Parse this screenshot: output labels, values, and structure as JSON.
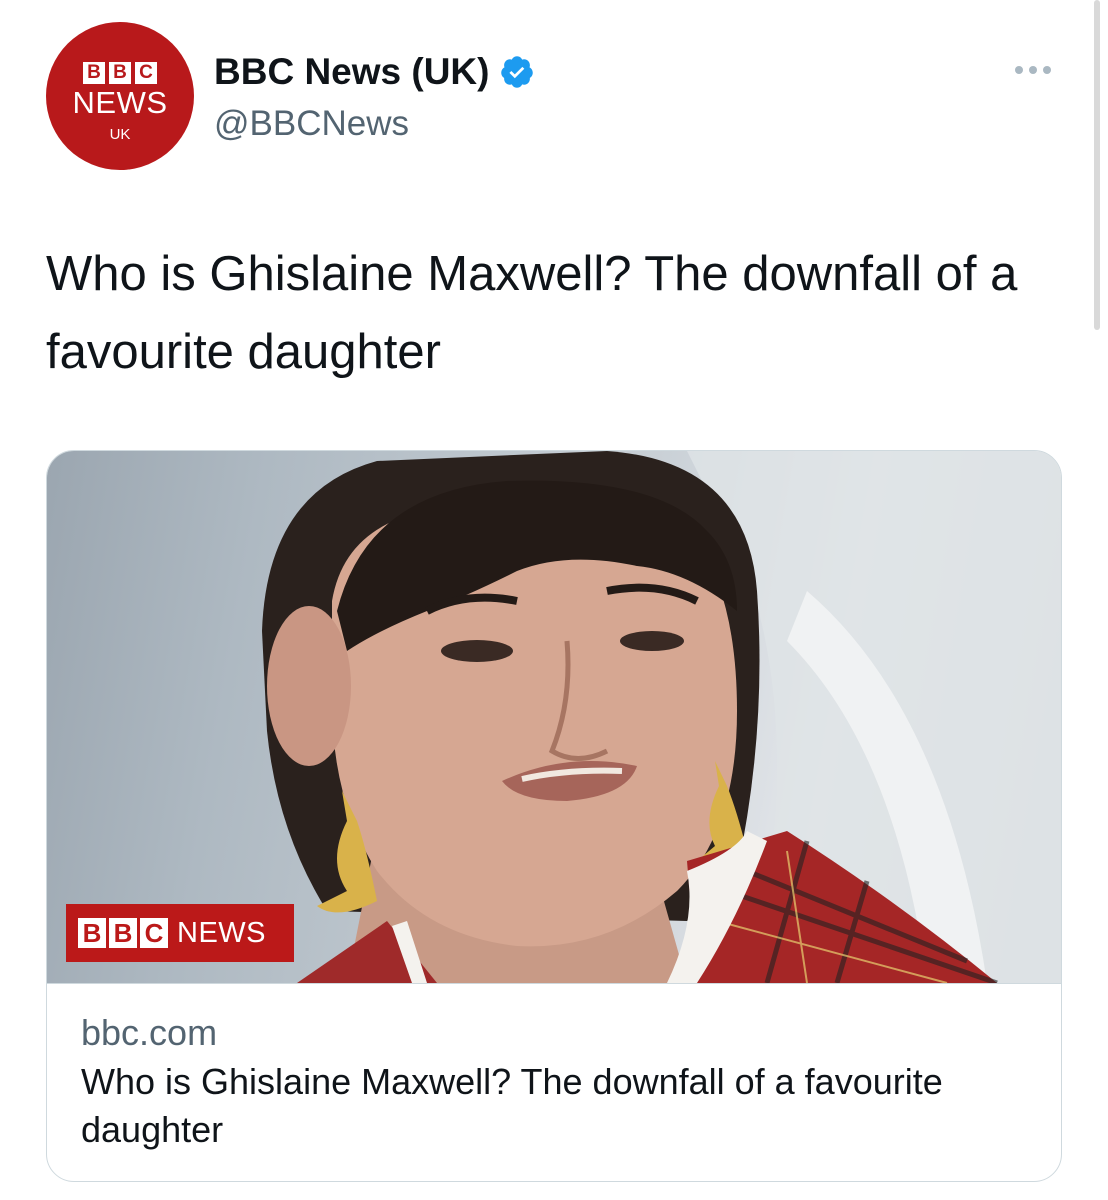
{
  "author": {
    "avatar": {
      "blocks": [
        "B",
        "B",
        "C"
      ],
      "news": "NEWS",
      "region": "UK",
      "color": "#b8191b"
    },
    "display_name": "BBC News (UK)",
    "verified": true,
    "verified_color": "#1d9bf0",
    "handle": "@BBCNews"
  },
  "tweet": {
    "text": "Who is Ghislaine Maxwell? The downfall of a favourite daughter"
  },
  "card": {
    "image_logo": {
      "blocks": [
        "B",
        "B",
        "C"
      ],
      "news": "NEWS",
      "color": "#bb1919"
    },
    "domain": "bbc.com",
    "title": "Who is Ghislaine Maxwell? The downfall of a favourite daughter"
  },
  "icons": {
    "more": "more-horizontal-icon",
    "verified": "verified-badge-icon"
  }
}
